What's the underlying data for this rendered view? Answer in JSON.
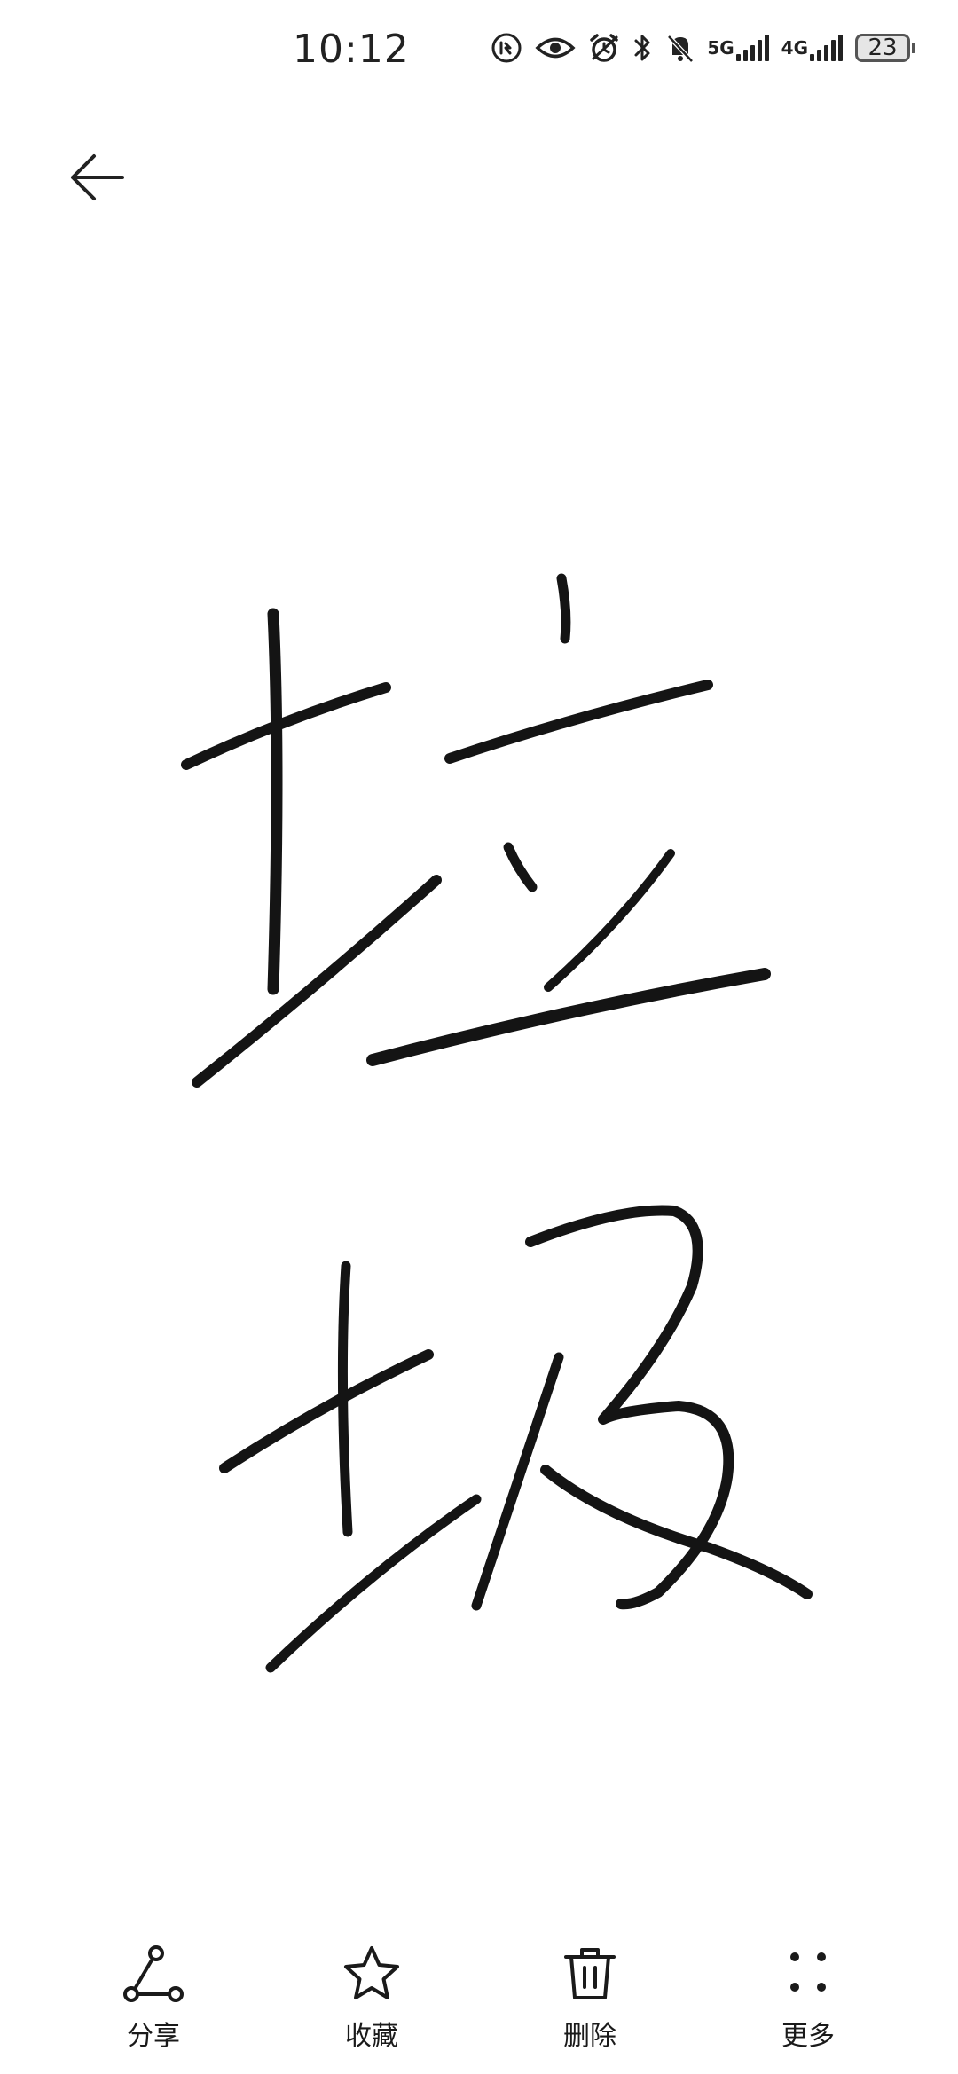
{
  "status_bar": {
    "time": "10:12",
    "network_5g": "5G",
    "network_4g": "4G",
    "battery": "23",
    "icons": [
      "data-saver-icon",
      "eye-comfort-icon",
      "alarm-icon",
      "bluetooth-icon",
      "mute-icon",
      "signal-5g-icon",
      "signal-4g-icon",
      "battery-icon"
    ]
  },
  "header": {
    "back_icon": "arrow-left-icon"
  },
  "canvas": {
    "handwritten_content": "垃圾"
  },
  "toolbar": {
    "share_label": "分享",
    "favorite_label": "收藏",
    "delete_label": "删除",
    "more_label": "更多"
  }
}
